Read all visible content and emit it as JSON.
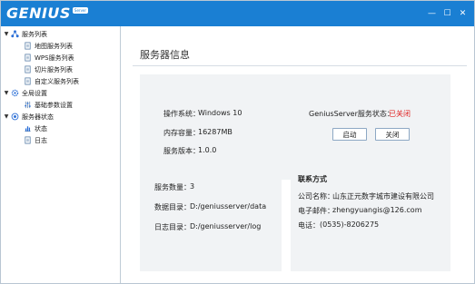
{
  "app": {
    "logo_text": "GENIUS",
    "logo_badge": "Server"
  },
  "window_controls": {
    "minimize": "—",
    "maximize": "☐",
    "close": "✕"
  },
  "sidebar": {
    "groups": [
      {
        "label": "服务列表",
        "icon": "server-list-icon",
        "items": [
          {
            "label": "地图服务列表",
            "icon": "document-icon"
          },
          {
            "label": "WPS服务列表",
            "icon": "document-icon"
          },
          {
            "label": "切片服务列表",
            "icon": "document-icon"
          },
          {
            "label": "自定义服务列表",
            "icon": "document-icon"
          }
        ]
      },
      {
        "label": "全局设置",
        "icon": "gear-icon",
        "items": [
          {
            "label": "基础参数设置",
            "icon": "sliders-icon"
          }
        ]
      },
      {
        "label": "服务器状态",
        "icon": "status-icon",
        "items": [
          {
            "label": "状态",
            "icon": "chart-icon"
          },
          {
            "label": "日志",
            "icon": "document-icon"
          }
        ]
      }
    ]
  },
  "main": {
    "title": "服务器信息",
    "info": {
      "os_label": "操作系统：",
      "os_value": "Windows 10",
      "memory_label": "内存容量：",
      "memory_value": "16287MB",
      "version_label": "服务版本：",
      "version_value": "1.0.0",
      "status_label": "GeniusServer服务状态：",
      "status_value": "已关闭",
      "start_button": "启动",
      "stop_button": "关闭"
    },
    "stats": {
      "count_label": "服务数量：",
      "count_value": "3",
      "data_dir_label": "数据目录：",
      "data_dir_value": "D:/geniusserver/data",
      "log_dir_label": "日志目录：",
      "log_dir_value": "D:/geniusserver/log"
    },
    "contact": {
      "title": "联系方式",
      "company_label": "公司名称：",
      "company_value": "山东正元数字城市建设有限公司",
      "email_label": "电子邮件：",
      "email_value": "zhengyuangis@126.com",
      "phone_label": "电话：",
      "phone_value": "(0535)-8206275"
    }
  },
  "colors": {
    "titlebar": "#1a7fd3",
    "accent_icon": "#2b6fd6",
    "status_closed": "#e02020",
    "card_bg": "#f1f3f5"
  }
}
